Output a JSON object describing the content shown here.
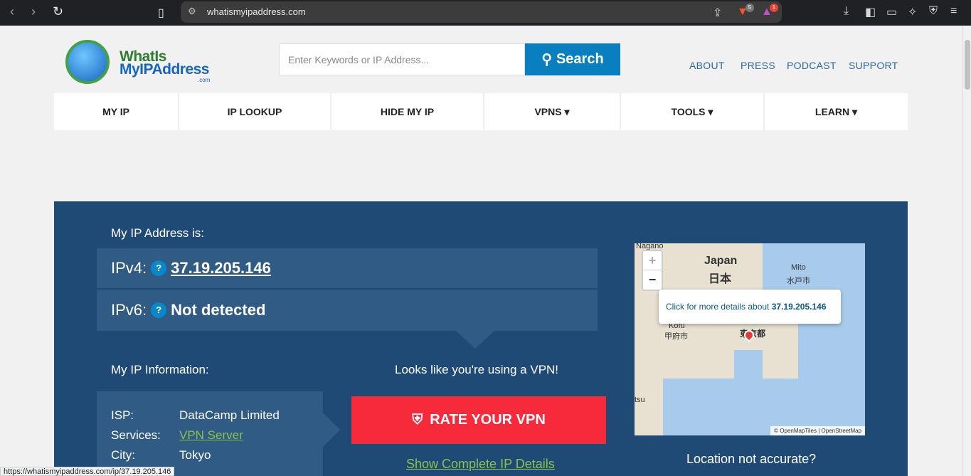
{
  "browser": {
    "url": "whatismyipaddress.com",
    "brave_badge": "5",
    "alert_badge": "1",
    "status_url": "https://whatismyipaddress.com/ip/37.19.205.146"
  },
  "logo": {
    "line1": "WhatIs",
    "line2": "MyIPAddress",
    "line3": ".com"
  },
  "search": {
    "placeholder": "Enter Keywords or IP Address...",
    "button_label": "Search"
  },
  "top_links": [
    "ABOUT",
    "PRESS",
    "PODCAST",
    "SUPPORT"
  ],
  "menu": [
    {
      "label": "MY IP"
    },
    {
      "label": "IP LOOKUP"
    },
    {
      "label": "HIDE MY IP"
    },
    {
      "label": "VPNS ▾"
    },
    {
      "label": "TOOLS ▾"
    },
    {
      "label": "LEARN ▾"
    }
  ],
  "ip_panel": {
    "heading": "My IP Address is:",
    "ipv4_label": "IPv4:",
    "ipv4_value": "37.19.205.146",
    "ipv6_label": "IPv6:",
    "ipv6_value": "Not detected",
    "help": "?",
    "info_heading": "My IP Information:",
    "vpn_notice": "Looks like you're using a VPN!",
    "rate_button": "RATE YOUR VPN",
    "details_link": "Show Complete IP Details",
    "location_question": "Location not accurate?",
    "info": {
      "isp_label": "ISP:",
      "isp_value": "DataCamp Limited",
      "services_label": "Services:",
      "services_value": "VPN Server",
      "city_label": "City:",
      "city_value": "Tokyo"
    }
  },
  "map": {
    "labels": {
      "nagano": "Nagano",
      "japan_en": "Japan",
      "japan_ja": "日本",
      "mito_en": "Mito",
      "mito_ja": "水戸市",
      "kofu_en": "Kofu",
      "kofu_ja": "甲府市",
      "tokyo_ja": "東京都",
      "tsu": "tsu"
    },
    "zoom_in": "+",
    "zoom_out": "−",
    "popup_text": "Click for more details about",
    "popup_ip": "37.19.205.146",
    "attribution": "© OpenMapTiles | OpenStreetMap"
  }
}
